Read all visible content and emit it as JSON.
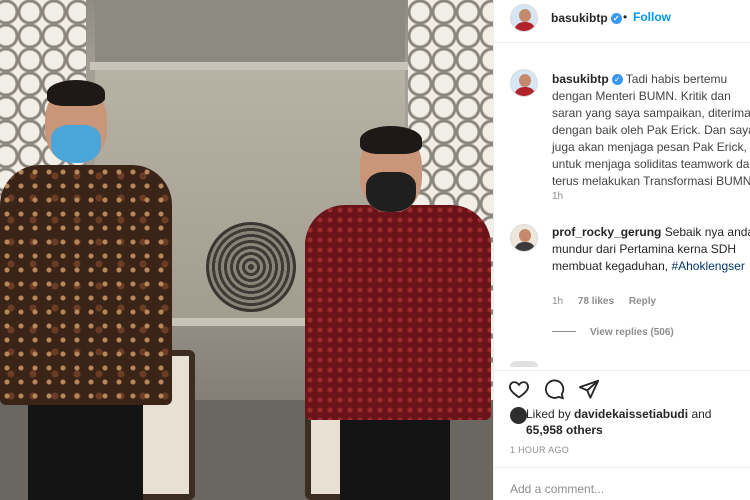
{
  "post": {
    "username": "basukibtp",
    "follow_label": "Follow",
    "dot_separator": "•",
    "caption": "Tadi habis bertemu dengan Menteri BUMN. Kritik dan saran yang saya sampaikan, diterima dengan baik oleh Pak Erick. Dan saya juga akan menjaga pesan Pak Erick, untuk menjaga soliditas teamwork dan terus melakukan Transformasi BUMN.",
    "caption_time": "1h",
    "likes_prefix": "Liked by",
    "liked_by_user": "davidekaissetiabudi",
    "likes_and": "and",
    "likes_others": "65,958 others",
    "posted_time": "1 HOUR AGO",
    "add_comment_placeholder": "Add a comment..."
  },
  "comment": {
    "username": "prof_rocky_gerung",
    "text": "Sebaik nya anda mundur dari Pertamina kerna SDH membuat kegaduhan,",
    "hashtag": "#Ahoklengser",
    "time": "1h",
    "likes": "78 likes",
    "reply_label": "Reply",
    "view_replies": "View replies (506)"
  },
  "icons": {
    "verified": "verified-badge-icon",
    "like": "heart-icon",
    "comment": "comment-bubble-icon",
    "share": "paper-plane-icon"
  },
  "colors": {
    "link": "#0095f6",
    "verified": "#3897f0",
    "muted": "#8e8e8e",
    "hashtag": "#00376b"
  }
}
